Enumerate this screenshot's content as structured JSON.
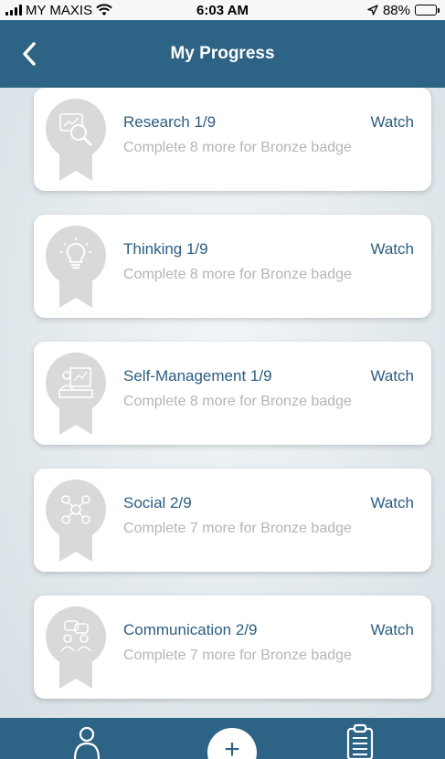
{
  "status": {
    "carrier": "MY MAXIS",
    "time": "6:03 AM",
    "battery": "88%",
    "battery_level": 0.88
  },
  "header": {
    "title": "My Progress",
    "back_icon": "chevron-left-icon"
  },
  "cards": [
    {
      "title": "Research 1/9",
      "subtitle": "Complete 8 more for Bronze badge",
      "action": "Watch",
      "icon": "research-icon"
    },
    {
      "title": "Thinking 1/9",
      "subtitle": "Complete 8 more for Bronze badge",
      "action": "Watch",
      "icon": "lightbulb-icon"
    },
    {
      "title": "Self-Management 1/9",
      "subtitle": "Complete 8 more for Bronze badge",
      "action": "Watch",
      "icon": "self-management-icon"
    },
    {
      "title": "Social 2/9",
      "subtitle": "Complete 7 more for Bronze badge",
      "action": "Watch",
      "icon": "social-network-icon"
    },
    {
      "title": "Communication 2/9",
      "subtitle": "Complete 7 more for Bronze badge",
      "action": "Watch",
      "icon": "communication-icon"
    }
  ],
  "tabbar": {
    "items": [
      {
        "icon": "profile-icon"
      },
      {
        "icon": "add-icon",
        "label": "+"
      },
      {
        "icon": "clipboard-icon"
      }
    ]
  },
  "colors": {
    "primary": "#2d6385",
    "accent_text": "#2a5d80",
    "muted_text": "#b5b5b5",
    "badge_gray": "#d9d9d9"
  }
}
